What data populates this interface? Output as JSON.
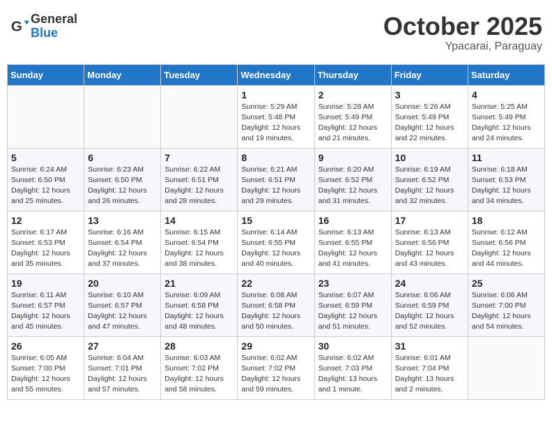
{
  "header": {
    "logo_line1": "General",
    "logo_line2": "Blue",
    "month": "October 2025",
    "location": "Ypacarai, Paraguay"
  },
  "weekdays": [
    "Sunday",
    "Monday",
    "Tuesday",
    "Wednesday",
    "Thursday",
    "Friday",
    "Saturday"
  ],
  "weeks": [
    [
      {
        "day": "",
        "info": ""
      },
      {
        "day": "",
        "info": ""
      },
      {
        "day": "",
        "info": ""
      },
      {
        "day": "1",
        "info": "Sunrise: 5:29 AM\nSunset: 5:48 PM\nDaylight: 12 hours and 19 minutes."
      },
      {
        "day": "2",
        "info": "Sunrise: 5:28 AM\nSunset: 5:49 PM\nDaylight: 12 hours and 21 minutes."
      },
      {
        "day": "3",
        "info": "Sunrise: 5:26 AM\nSunset: 5:49 PM\nDaylight: 12 hours and 22 minutes."
      },
      {
        "day": "4",
        "info": "Sunrise: 5:25 AM\nSunset: 5:49 PM\nDaylight: 12 hours and 24 minutes."
      }
    ],
    [
      {
        "day": "5",
        "info": "Sunrise: 6:24 AM\nSunset: 6:50 PM\nDaylight: 12 hours and 25 minutes."
      },
      {
        "day": "6",
        "info": "Sunrise: 6:23 AM\nSunset: 6:50 PM\nDaylight: 12 hours and 26 minutes."
      },
      {
        "day": "7",
        "info": "Sunrise: 6:22 AM\nSunset: 6:51 PM\nDaylight: 12 hours and 28 minutes."
      },
      {
        "day": "8",
        "info": "Sunrise: 6:21 AM\nSunset: 6:51 PM\nDaylight: 12 hours and 29 minutes."
      },
      {
        "day": "9",
        "info": "Sunrise: 6:20 AM\nSunset: 6:52 PM\nDaylight: 12 hours and 31 minutes."
      },
      {
        "day": "10",
        "info": "Sunrise: 6:19 AM\nSunset: 6:52 PM\nDaylight: 12 hours and 32 minutes."
      },
      {
        "day": "11",
        "info": "Sunrise: 6:18 AM\nSunset: 6:53 PM\nDaylight: 12 hours and 34 minutes."
      }
    ],
    [
      {
        "day": "12",
        "info": "Sunrise: 6:17 AM\nSunset: 6:53 PM\nDaylight: 12 hours and 35 minutes."
      },
      {
        "day": "13",
        "info": "Sunrise: 6:16 AM\nSunset: 6:54 PM\nDaylight: 12 hours and 37 minutes."
      },
      {
        "day": "14",
        "info": "Sunrise: 6:15 AM\nSunset: 6:54 PM\nDaylight: 12 hours and 38 minutes."
      },
      {
        "day": "15",
        "info": "Sunrise: 6:14 AM\nSunset: 6:55 PM\nDaylight: 12 hours and 40 minutes."
      },
      {
        "day": "16",
        "info": "Sunrise: 6:13 AM\nSunset: 6:55 PM\nDaylight: 12 hours and 41 minutes."
      },
      {
        "day": "17",
        "info": "Sunrise: 6:13 AM\nSunset: 6:56 PM\nDaylight: 12 hours and 43 minutes."
      },
      {
        "day": "18",
        "info": "Sunrise: 6:12 AM\nSunset: 6:56 PM\nDaylight: 12 hours and 44 minutes."
      }
    ],
    [
      {
        "day": "19",
        "info": "Sunrise: 6:11 AM\nSunset: 6:57 PM\nDaylight: 12 hours and 45 minutes."
      },
      {
        "day": "20",
        "info": "Sunrise: 6:10 AM\nSunset: 6:57 PM\nDaylight: 12 hours and 47 minutes."
      },
      {
        "day": "21",
        "info": "Sunrise: 6:09 AM\nSunset: 6:58 PM\nDaylight: 12 hours and 48 minutes."
      },
      {
        "day": "22",
        "info": "Sunrise: 6:08 AM\nSunset: 6:58 PM\nDaylight: 12 hours and 50 minutes."
      },
      {
        "day": "23",
        "info": "Sunrise: 6:07 AM\nSunset: 6:59 PM\nDaylight: 12 hours and 51 minutes."
      },
      {
        "day": "24",
        "info": "Sunrise: 6:06 AM\nSunset: 6:59 PM\nDaylight: 12 hours and 52 minutes."
      },
      {
        "day": "25",
        "info": "Sunrise: 6:06 AM\nSunset: 7:00 PM\nDaylight: 12 hours and 54 minutes."
      }
    ],
    [
      {
        "day": "26",
        "info": "Sunrise: 6:05 AM\nSunset: 7:00 PM\nDaylight: 12 hours and 55 minutes."
      },
      {
        "day": "27",
        "info": "Sunrise: 6:04 AM\nSunset: 7:01 PM\nDaylight: 12 hours and 57 minutes."
      },
      {
        "day": "28",
        "info": "Sunrise: 6:03 AM\nSunset: 7:02 PM\nDaylight: 12 hours and 58 minutes."
      },
      {
        "day": "29",
        "info": "Sunrise: 6:02 AM\nSunset: 7:02 PM\nDaylight: 12 hours and 59 minutes."
      },
      {
        "day": "30",
        "info": "Sunrise: 6:02 AM\nSunset: 7:03 PM\nDaylight: 13 hours and 1 minute."
      },
      {
        "day": "31",
        "info": "Sunrise: 6:01 AM\nSunset: 7:04 PM\nDaylight: 13 hours and 2 minutes."
      },
      {
        "day": "",
        "info": ""
      }
    ]
  ]
}
